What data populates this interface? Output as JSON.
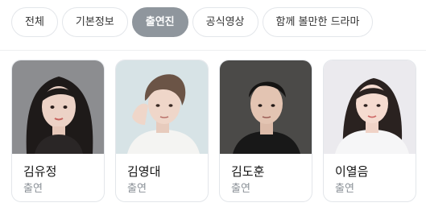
{
  "tabs": [
    {
      "label": "전체",
      "active": false
    },
    {
      "label": "기본정보",
      "active": false
    },
    {
      "label": "출연진",
      "active": true
    },
    {
      "label": "공식영상",
      "active": false
    },
    {
      "label": "함께 볼만한 드라마",
      "active": false
    }
  ],
  "cast": [
    {
      "name": "김유정",
      "role": "출연"
    },
    {
      "name": "김영대",
      "role": "출연"
    },
    {
      "name": "김도훈",
      "role": "출연"
    },
    {
      "name": "이열음",
      "role": "출연"
    }
  ]
}
